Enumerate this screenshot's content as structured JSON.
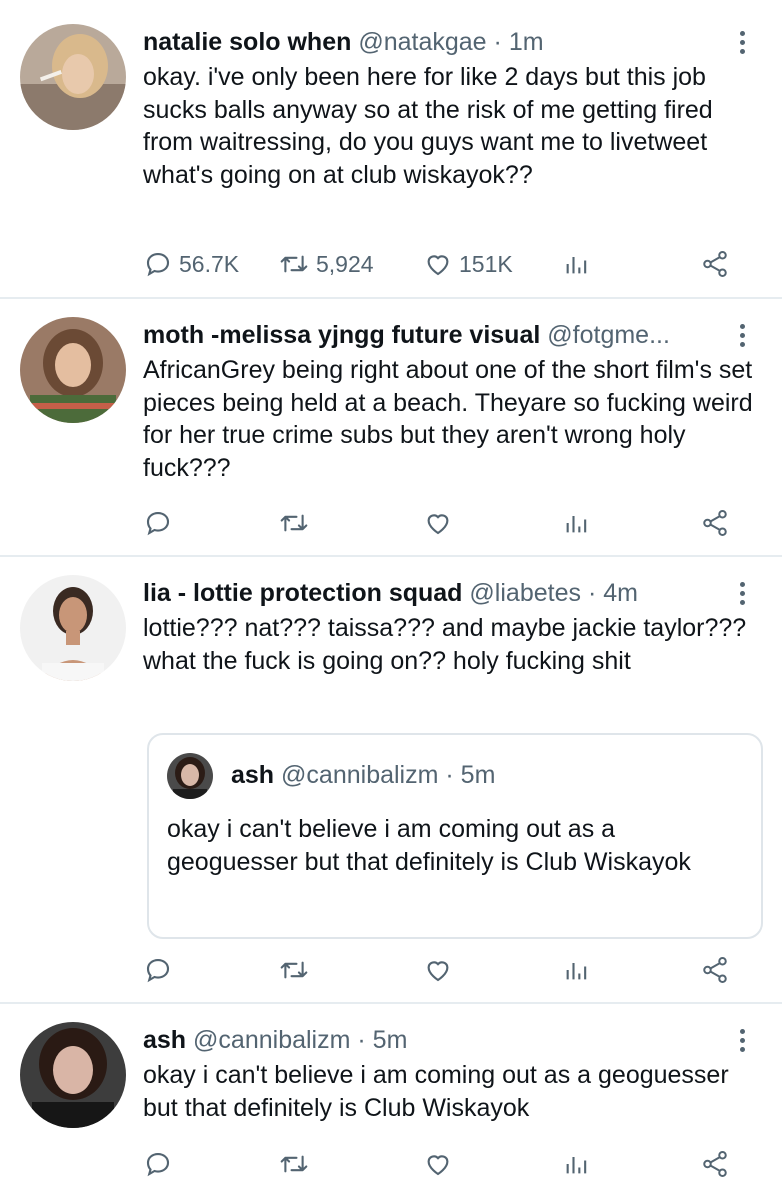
{
  "tweets": [
    {
      "name": "natalie solo when",
      "handle": "@natakgae",
      "dot": "·",
      "time": "1m",
      "text": "okay. i've only been here for like 2 days but this job sucks balls anyway so at the risk of me getting fired from waitressing, do you guys want me to livetweet what's going on at club wiskayok??",
      "replies": "56.7K",
      "retweets": "5,924",
      "likes": "151K"
    },
    {
      "name": "moth -melissa yjngg future visual",
      "handle": "@fotgme...",
      "dot": "",
      "time": "",
      "text": "AfricanGrey being right about one of the short film's set pieces being held at a beach. Theyare so fucking weird for her true crime subs but they aren't wrong holy fuck???",
      "replies": "",
      "retweets": "",
      "likes": ""
    },
    {
      "name": "lia - lottie protection squad",
      "handle": "@liabetes",
      "dot": "·",
      "time": "4m",
      "text": "lottie??? nat??? taissa??? and maybe jackie taylor??? what the fuck is going on?? holy fucking shit",
      "replies": "",
      "retweets": "",
      "likes": "",
      "quote": {
        "name": "ash",
        "handle": "@cannibalizm",
        "dot": "·",
        "time": "5m",
        "text": "okay i can't believe i am coming out as a geoguesser but that definitely is Club Wiskayok"
      }
    },
    {
      "name": "ash",
      "handle": "@cannibalizm",
      "dot": "·",
      "time": "5m",
      "text": "okay i can't believe i am coming out as a geoguesser but that definitely is Club Wiskayok",
      "replies": "",
      "retweets": "",
      "likes": ""
    }
  ],
  "icons": {
    "reply": "reply-icon",
    "retweet": "retweet-icon",
    "like": "heart-icon",
    "analytics": "analytics-icon",
    "share": "share-icon",
    "more": "more-vertical-icon"
  },
  "colors": {
    "text": "#0f1419",
    "secondary": "#536471",
    "divider": "#e6ecf0"
  }
}
